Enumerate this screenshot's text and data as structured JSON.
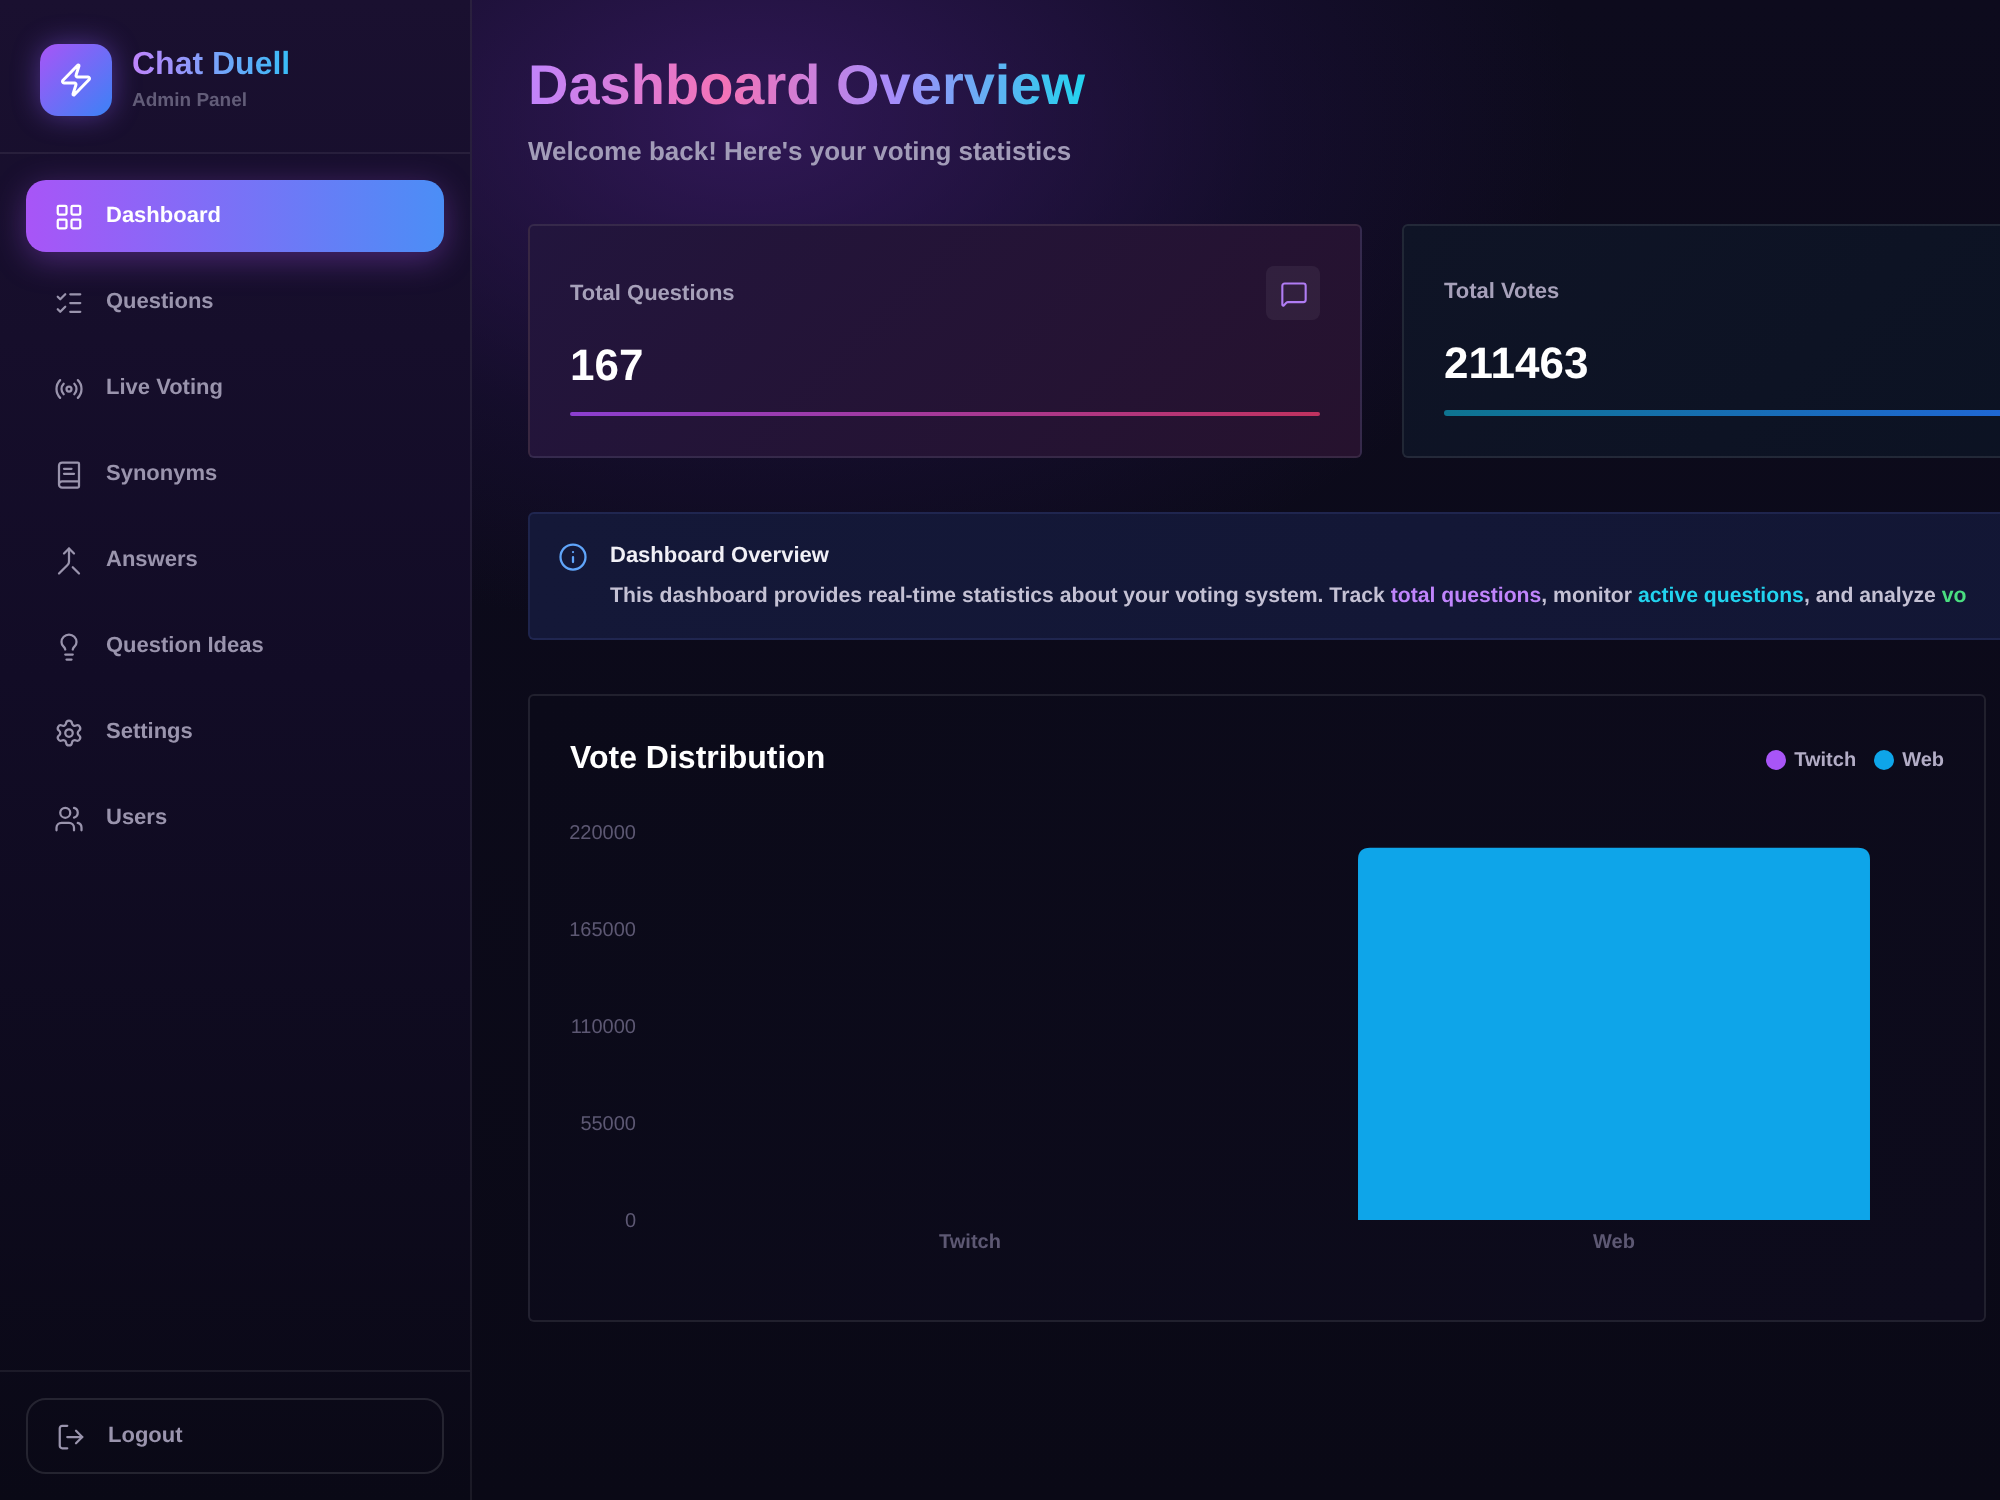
{
  "sidebar": {
    "brand": {
      "name": "Chat Duell",
      "subtitle": "Admin Panel"
    },
    "items": [
      {
        "label": "Dashboard",
        "selected": true
      },
      {
        "label": "Questions",
        "selected": false
      },
      {
        "label": "Live Voting",
        "selected": false
      },
      {
        "label": "Synonyms",
        "selected": false
      },
      {
        "label": "Answers",
        "selected": false
      },
      {
        "label": "Question Ideas",
        "selected": false
      },
      {
        "label": "Settings",
        "selected": false
      },
      {
        "label": "Users",
        "selected": false
      }
    ],
    "logout": {
      "label": "Logout"
    }
  },
  "header": {
    "title": "Dashboard Overview",
    "subtitle": "Welcome back! Here's your voting statistics"
  },
  "stats": [
    {
      "kind": "questions",
      "label": "Total Questions",
      "value": "167"
    },
    {
      "kind": "votes",
      "label": "Total Votes",
      "value": "211463"
    }
  ],
  "info_banner": {
    "title": "Dashboard Overview",
    "segments": [
      {
        "text": "This dashboard provides real-time statistics about your voting system. Track "
      },
      {
        "text": "total questions",
        "color": "#c084fc"
      },
      {
        "text": ", monitor "
      },
      {
        "text": "active questions",
        "color": "#22d3ee"
      },
      {
        "text": ", and analyze "
      },
      {
        "text": "vo",
        "color": "#4ade80"
      }
    ]
  },
  "vote_distribution": {
    "title": "Vote Distribution",
    "chart_data": {
      "type": "bar",
      "categories": [
        "Twitch",
        "Web"
      ],
      "series": [
        {
          "name": "Twitch",
          "color": "#a855f7",
          "values": [
            0,
            null
          ]
        },
        {
          "name": "Web",
          "color": "#0ea5e9",
          "values": [
            null,
            211000
          ]
        }
      ],
      "stacked": true,
      "ylim": [
        0,
        220000
      ],
      "yticks": [
        0,
        55000,
        110000,
        165000,
        220000
      ]
    }
  }
}
